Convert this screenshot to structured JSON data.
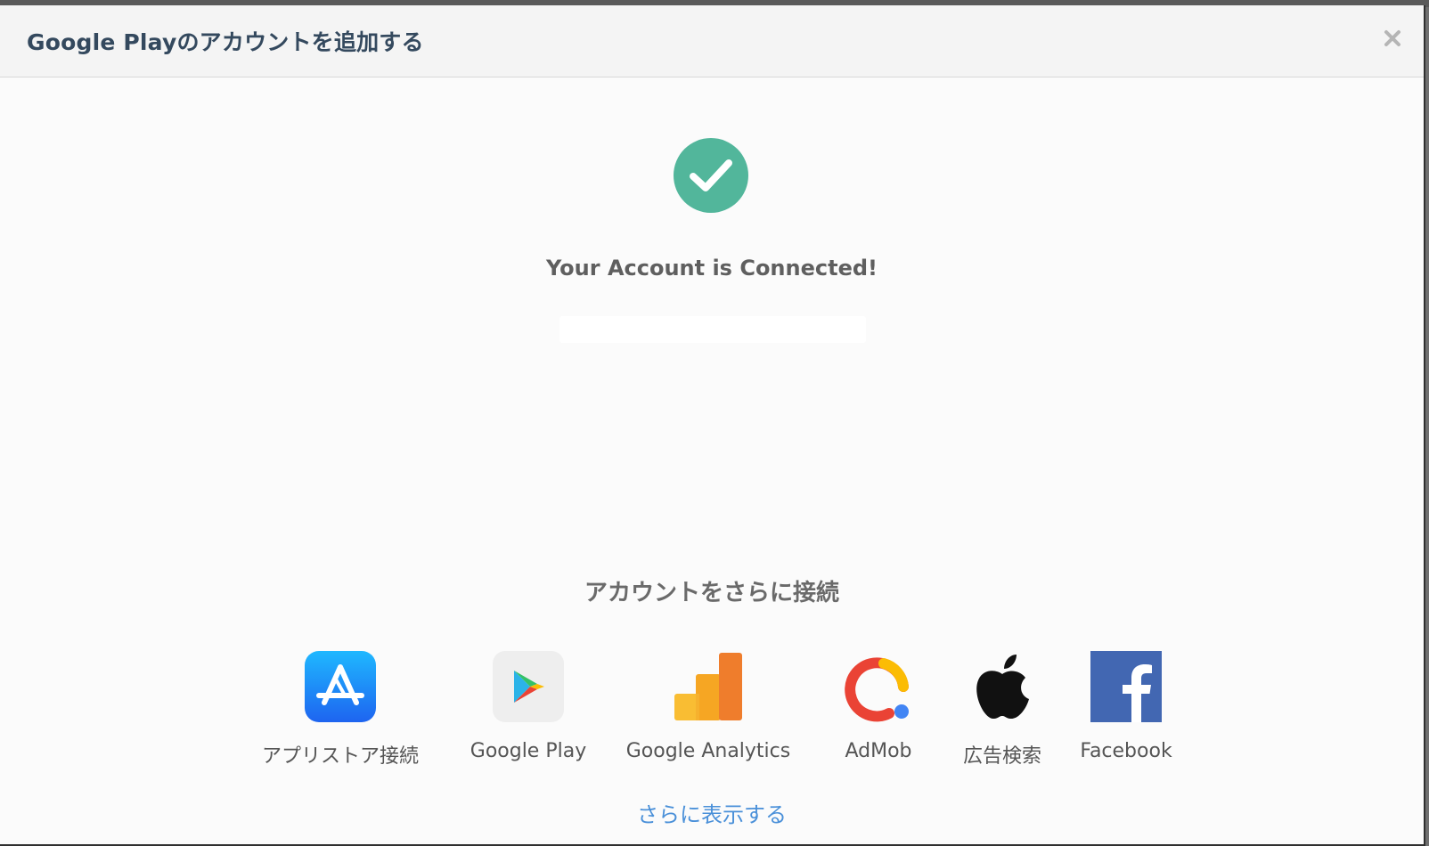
{
  "modal": {
    "title": "Google Playのアカウントを追加する"
  },
  "status": {
    "message": "Your Account is Connected!",
    "accent_color": "#52b69b"
  },
  "more_accounts": {
    "heading": "アカウントをさらに接続",
    "services": [
      {
        "label": "アプリストア接続",
        "icon": "app-store-icon"
      },
      {
        "label": "Google Play",
        "icon": "google-play-icon"
      },
      {
        "label": "Google Analytics",
        "icon": "google-analytics-icon"
      },
      {
        "label": "AdMob",
        "icon": "admob-icon"
      },
      {
        "label": "広告検索",
        "icon": "apple-icon"
      },
      {
        "label": "Facebook",
        "icon": "facebook-icon"
      }
    ],
    "show_more": "さらに表示する"
  },
  "colors": {
    "title": "#34495e",
    "link": "#4a90d9",
    "facebook": "#4267b2",
    "app_store": "#1a8cff"
  }
}
